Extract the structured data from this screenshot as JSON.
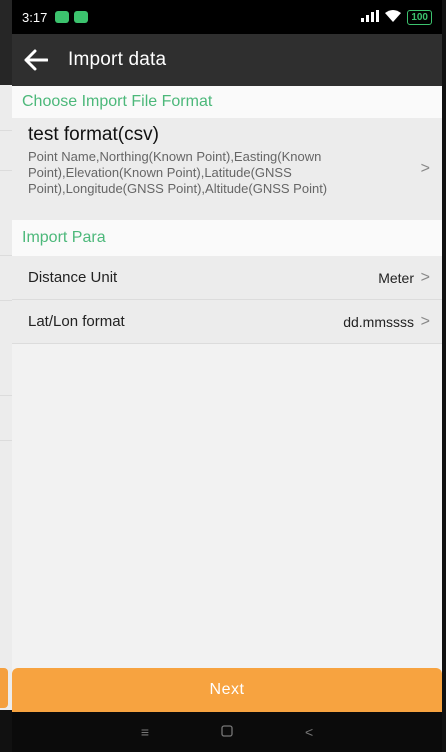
{
  "status_bar": {
    "time": "3:17",
    "battery": "100"
  },
  "toolbar": {
    "title": "Import data"
  },
  "sections": {
    "file_format_header": "Choose Import File Format",
    "import_para_header": "Import Para"
  },
  "format": {
    "name": "test format(csv)",
    "fields": "Point Name,Northing(Known Point),Easting(Known Point),Elevation(Known Point),Latitude(GNSS Point),Longitude(GNSS Point),Altitude(GNSS Point)"
  },
  "params": [
    {
      "label": "Distance Unit",
      "value": "Meter"
    },
    {
      "label": "Lat/Lon format",
      "value": "dd.mmssss"
    }
  ],
  "next_button": {
    "label": "Next"
  },
  "colors": {
    "accent_green": "#4cb87a",
    "button_orange": "#f7a340",
    "toolbar": "#2f2f2f"
  },
  "icons": [
    "back-arrow-icon",
    "chevron-right-icon",
    "signal-icon",
    "wifi-icon",
    "battery-icon",
    "menu-icon",
    "home-icon",
    "back-nav-icon"
  ]
}
